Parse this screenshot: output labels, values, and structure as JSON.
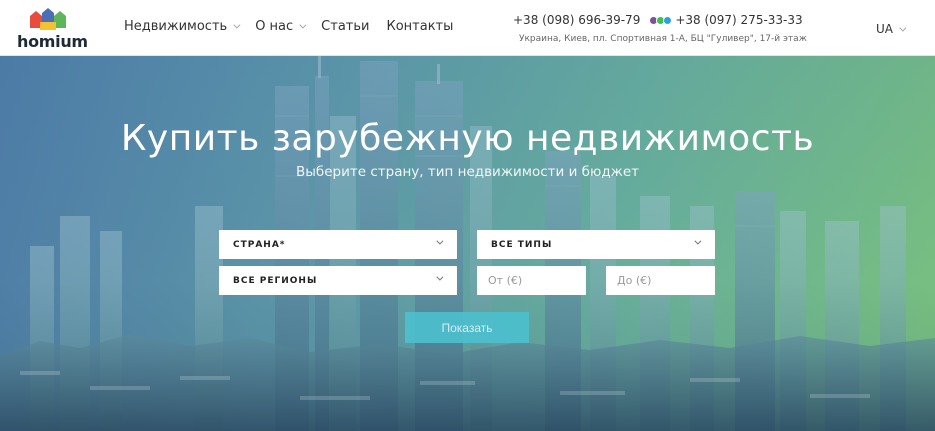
{
  "brand": {
    "name": "homium"
  },
  "nav": [
    {
      "label": "Недвижимость",
      "has_dropdown": true
    },
    {
      "label": "О нас",
      "has_dropdown": true
    },
    {
      "label": "Статьи",
      "has_dropdown": false
    },
    {
      "label": "Контакты",
      "has_dropdown": false
    }
  ],
  "contacts": {
    "phone_1": "+38 (098) 696-39-79",
    "phone_2": "+38 (097) 275-33-33",
    "address": "Украина, Киев, пл. Спортивная 1-А, БЦ \"Гуливер\", 17-й этаж",
    "flag_icon": "ukraine-flag-icon",
    "messenger_icons": [
      "viber-icon",
      "whatsapp-icon",
      "telegram-icon"
    ]
  },
  "language": {
    "current": "UA"
  },
  "hero": {
    "title": "Купить зарубежную недвижимость",
    "subtitle": "Выберите страну, тип недвижимости и бюджет"
  },
  "search": {
    "country_label": "СТРАНА*",
    "types_label": "ВСЕ ТИПЫ",
    "regions_label": "ВСЕ РЕГИОНЫ",
    "price_from_placeholder": "От (€)",
    "price_to_placeholder": "До (€)",
    "submit_label": "Показать"
  },
  "colors": {
    "accent_button": "#4dc0cf",
    "hero_gradient_start": "#4e7ca6",
    "hero_gradient_end": "#78c07f"
  }
}
